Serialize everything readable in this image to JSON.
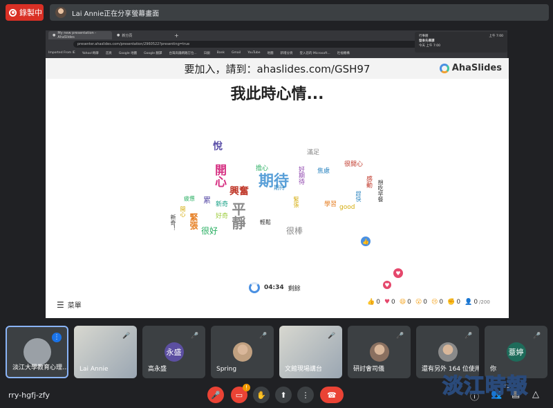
{
  "recording": {
    "label": "錄製中"
  },
  "presenter_banner": {
    "text": "Lai Annie正在分享螢幕畫面"
  },
  "browser": {
    "tab_active": "My new presentation - AhaSlides",
    "tab_other": "新分頁",
    "new_tab": "+",
    "url": "presenter.ahaslides.com/presentation/2960522?presenting=true",
    "bookmarks": [
      "Imported From IE",
      "Yahoo!奇摩",
      "首頁",
      "Google 地圖",
      "Google 翻譯",
      "台灣高鐵網路訂位...",
      "日劇",
      "Bank",
      "Gmail",
      "YouTube",
      "地圖",
      "新增分頁",
      "登入您的 Microsoft...",
      "社福機構"
    ]
  },
  "notification": {
    "app": "行事曆",
    "time1": "上午 7:00",
    "title": "發身先導課",
    "time2": "今天 上午 7:00"
  },
  "slide": {
    "join_text": "要加入，請到：ahaslides.com/GSH97",
    "logo": "AhaSlides",
    "title": "我此時心情...",
    "timer": "04:34",
    "timer_label": "剩餘",
    "menu_label": "菜單",
    "reactions": [
      {
        "icon": "thumbs-up",
        "count": "0",
        "color": "#4a90e2"
      },
      {
        "icon": "heart",
        "count": "0",
        "color": "#e5486c"
      },
      {
        "icon": "laugh",
        "count": "0",
        "color": "#f5a623"
      },
      {
        "icon": "wow",
        "count": "0",
        "color": "#f5a623"
      },
      {
        "icon": "sad",
        "count": "0",
        "color": "#f5a623"
      },
      {
        "icon": "clap",
        "count": "0",
        "color": "#333333"
      }
    ],
    "participants_count": "0",
    "participants_max": "/200",
    "words": [
      {
        "text": "期待",
        "color": "#5aa0d8"
      },
      {
        "text": "平靜",
        "color": "#8a8a8a"
      },
      {
        "text": "開心",
        "color": "#d63384"
      },
      {
        "text": "興奮",
        "color": "#c0392b"
      },
      {
        "text": "悅",
        "color": "#5b4fa8"
      },
      {
        "text": "很棒",
        "color": "#888888"
      },
      {
        "text": "很好",
        "color": "#27ae60"
      },
      {
        "text": "緊張",
        "color": "#e67e22"
      },
      {
        "text": "累",
        "color": "#5b4fa8"
      },
      {
        "text": "新奇",
        "color": "#16a085"
      },
      {
        "text": "好奇",
        "color": "#9ccc3c"
      },
      {
        "text": "輕鬆",
        "color": "#333333"
      },
      {
        "text": "擔心",
        "color": "#27ae60"
      },
      {
        "text": "滿足",
        "color": "#888888"
      },
      {
        "text": "焦慮",
        "color": "#2e86c1"
      },
      {
        "text": "很開心",
        "color": "#c0392b"
      },
      {
        "text": "好期待",
        "color": "#8e44ad"
      },
      {
        "text": "感動",
        "color": "#c0392b"
      },
      {
        "text": "想吃早餐",
        "color": "#333333"
      },
      {
        "text": "趕快",
        "color": "#2e86c1"
      },
      {
        "text": "學習",
        "color": "#e67e22"
      },
      {
        "text": "good",
        "color": "#d4ac0d"
      },
      {
        "text": "緊張",
        "color": "#d4ac0d"
      },
      {
        "text": "疲憊",
        "color": "#27ae60"
      },
      {
        "text": "開心",
        "color": "#d4ac0d"
      },
      {
        "text": "新奇！",
        "color": "#333333"
      },
      {
        "text": "期待",
        "color": "#2e86c1"
      }
    ]
  },
  "participants": [
    {
      "name": "淡江大學教育心理...",
      "avatar_color": "#5f6368"
    },
    {
      "name": "Lai Annie",
      "avatar_color": "#8a9bb0"
    },
    {
      "name": "高永盛",
      "initials": "永盛",
      "avatar_color": "#5c4fa1"
    },
    {
      "name": "Spring",
      "avatar_color": "#c0a080"
    },
    {
      "name": "文館現場講台",
      "avatar_color": "#c8c8c0"
    },
    {
      "name": "研討會司儀",
      "avatar_color": "#8a7060"
    },
    {
      "name": "還有另外 164 位使用者",
      "avatar_color": "#8a8a8a"
    },
    {
      "name": "你",
      "initials": "薏婷",
      "avatar_color": "#1e6b5a"
    }
  ],
  "bottom": {
    "meeting_code": "rry-hgfj-zfy",
    "people_badge": "172",
    "watermark": "淡江時報"
  }
}
